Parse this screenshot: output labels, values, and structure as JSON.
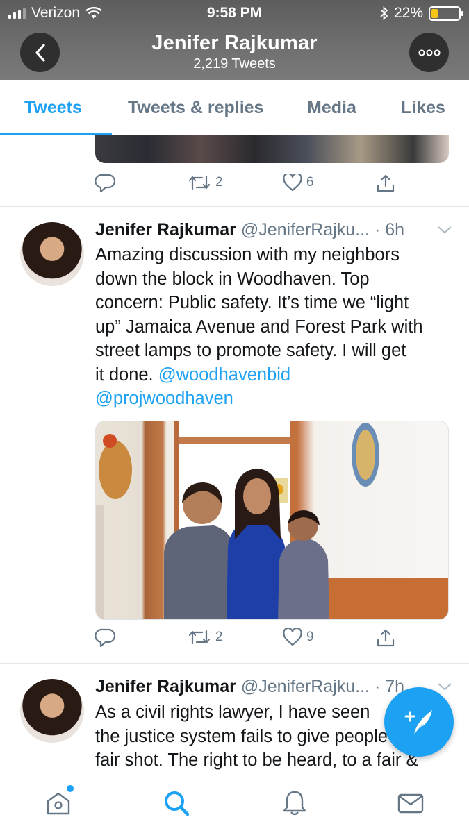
{
  "status_bar": {
    "carrier": "Verizon",
    "time": "9:58 PM",
    "battery": "22%",
    "battery_level": 0.22
  },
  "header": {
    "title": "Jenifer Rajkumar",
    "subtitle": "2,219 Tweets"
  },
  "tabs": [
    {
      "label": "Tweets",
      "active": true
    },
    {
      "label": "Tweets & replies",
      "active": false
    },
    {
      "label": "Media",
      "active": false
    },
    {
      "label": "Likes",
      "active": false
    }
  ],
  "tweets": [
    {
      "retweets": "2",
      "likes": "6"
    },
    {
      "name": "Jenifer Rajkumar",
      "handle": "@JeniferRajku...",
      "time": "· 6h",
      "lines": [
        "Amazing discussion with my neighbors",
        "down the block in Woodhaven. Top",
        "concern: Public safety. It’s time we “light",
        "up” Jamaica Avenue and Forest Park with",
        "street lamps to promote safety. I will get",
        "it done. "
      ],
      "mention1": "@woodhavenbid",
      "mention2": "@projwoodhaven",
      "retweets": "2",
      "likes": "9"
    },
    {
      "name": "Jenifer Rajkumar",
      "handle": "@JeniferRajku...",
      "time": "· 7h",
      "lines": [
        "As a civil rights lawyer, I have seen",
        "the justice system fails to give people a",
        "fair shot. The right to be heard, to a fair &"
      ]
    }
  ],
  "colors": {
    "accent": "#1da1f2",
    "muted": "#657786",
    "header_bg": "#6a6a6a"
  },
  "icons": [
    "back-icon",
    "more-icon",
    "reply-icon",
    "retweet-icon",
    "like-icon",
    "share-icon",
    "chevron-down-icon",
    "compose-icon",
    "home-icon",
    "search-icon",
    "notifications-icon",
    "messages-icon"
  ]
}
